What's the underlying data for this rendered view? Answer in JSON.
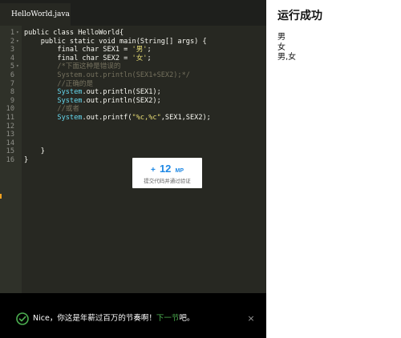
{
  "editor": {
    "tab_label": "HelloWorld.java",
    "lines": [
      {
        "n": "1",
        "fold": "▾",
        "tokens": [
          {
            "t": "public class HelloWorld{",
            "c": ""
          }
        ]
      },
      {
        "n": "2",
        "fold": "▾",
        "tokens": [
          {
            "t": "    public static void main(String[] args) {",
            "c": ""
          }
        ]
      },
      {
        "n": "3",
        "fold": "",
        "tokens": [
          {
            "t": "        final char SEX1 = ",
            "c": ""
          },
          {
            "t": "'男'",
            "c": "string"
          },
          {
            "t": ";",
            "c": ""
          }
        ]
      },
      {
        "n": "4",
        "fold": "",
        "tokens": [
          {
            "t": "        final char SEX2 = ",
            "c": ""
          },
          {
            "t": "'女'",
            "c": "string"
          },
          {
            "t": ";",
            "c": ""
          }
        ]
      },
      {
        "n": "5",
        "fold": "▾",
        "tokens": [
          {
            "t": "        /*下面这种是错误的",
            "c": "comment"
          }
        ]
      },
      {
        "n": "6",
        "fold": "",
        "tokens": [
          {
            "t": "        System.out.println(SEX1+SEX2);*/",
            "c": "comment"
          }
        ]
      },
      {
        "n": "7",
        "fold": "",
        "tokens": [
          {
            "t": "        //正确的是",
            "c": "comment"
          }
        ]
      },
      {
        "n": "8",
        "fold": "",
        "tokens": [
          {
            "t": "        System",
            "c": "keyword"
          },
          {
            "t": ".out.println(SEX1);",
            "c": ""
          }
        ]
      },
      {
        "n": "9",
        "fold": "",
        "tokens": [
          {
            "t": "        System",
            "c": "keyword"
          },
          {
            "t": ".out.println(SEX2);",
            "c": ""
          }
        ]
      },
      {
        "n": "10",
        "fold": "",
        "tokens": [
          {
            "t": "        //或者",
            "c": "comment"
          }
        ]
      },
      {
        "n": "11",
        "fold": "",
        "tokens": [
          {
            "t": "        System",
            "c": "keyword"
          },
          {
            "t": ".out.printf(",
            "c": ""
          },
          {
            "t": "\"%c,%c\"",
            "c": "string"
          },
          {
            "t": ",SEX1,SEX2);",
            "c": ""
          }
        ]
      },
      {
        "n": "12",
        "fold": "",
        "tokens": [
          {
            "t": "",
            "c": ""
          }
        ]
      },
      {
        "n": "13",
        "fold": "",
        "tokens": [
          {
            "t": "",
            "c": ""
          }
        ]
      },
      {
        "n": "14",
        "fold": "",
        "tokens": [
          {
            "t": "",
            "c": ""
          }
        ]
      },
      {
        "n": "15",
        "fold": "",
        "tokens": [
          {
            "t": "    }",
            "c": ""
          }
        ]
      },
      {
        "n": "16",
        "fold": "",
        "tokens": [
          {
            "t": "}",
            "c": ""
          }
        ]
      }
    ]
  },
  "reward": {
    "plus": "+",
    "amount": "12",
    "unit": "MP",
    "caption": "提交代码并通过验证"
  },
  "notice": {
    "icon": "check-circle-icon",
    "text_prefix": "Nice，你这是年薪过百万的节奏啊！",
    "link_text": "下一节",
    "text_suffix": "吧。",
    "close_icon": "close-icon",
    "close_glyph": "×",
    "accent_color": "#4caf50"
  },
  "output": {
    "title": "运行成功",
    "lines": [
      "男",
      "女",
      "男,女"
    ]
  },
  "colors": {
    "editor_bg": "#272822",
    "string": "#e6db74",
    "comment": "#75715e",
    "keyword": "#66d9ef",
    "reward_blue": "#1e88e5"
  }
}
